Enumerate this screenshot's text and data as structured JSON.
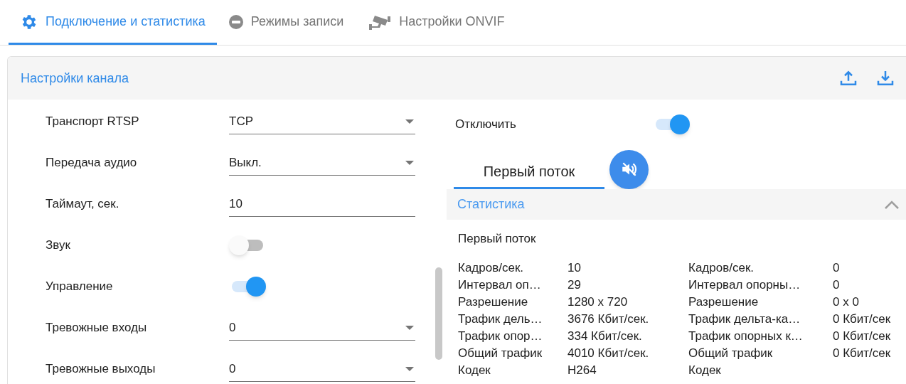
{
  "tabs": [
    {
      "label": "Подключение и статистика",
      "selected": true
    },
    {
      "label": "Режимы записи",
      "selected": false
    },
    {
      "label": "Настройки ONVIF",
      "selected": false
    }
  ],
  "panel": {
    "title": "Настройки канала",
    "settings": [
      {
        "kind": "select",
        "label": "Транспорт RTSP",
        "value": "TCP"
      },
      {
        "kind": "select",
        "label": "Передача аудио",
        "value": "Выкл."
      },
      {
        "kind": "input",
        "label": "Таймаут, сек.",
        "value": "10"
      },
      {
        "kind": "toggle",
        "label": "Звук",
        "on": false
      },
      {
        "kind": "toggle",
        "label": "Управление",
        "on": true
      },
      {
        "kind": "select",
        "label": "Тревожные входы",
        "value": "0"
      },
      {
        "kind": "select",
        "label": "Тревожные выходы",
        "value": "0"
      }
    ],
    "disable": {
      "label": "Отключить",
      "on": true
    },
    "stream_tabs": [
      {
        "label": "Первый поток",
        "selected": true
      }
    ],
    "statistics": {
      "title": "Статистика",
      "expanded": true,
      "stream_title": "Первый поток",
      "columns": [
        {
          "rows": [
            {
              "label": "Кадров/сек.",
              "value": "10"
            },
            {
              "label": "Интервал оп…",
              "value": "29"
            },
            {
              "label": "Разрешение",
              "value": "1280 x 720"
            },
            {
              "label": "Трафик дель…",
              "value": "3676 Кбит/сек."
            },
            {
              "label": "Трафик опор…",
              "value": "334 Кбит/сек."
            },
            {
              "label": "Общий трафик",
              "value": "4010 Кбит/сек."
            },
            {
              "label": "Кодек",
              "value": "H264"
            }
          ]
        },
        {
          "rows": [
            {
              "label": "Кадров/сек.",
              "value": "0"
            },
            {
              "label": "Интервал опорны…",
              "value": "0"
            },
            {
              "label": "Разрешение",
              "value": "0 x 0"
            },
            {
              "label": "Трафик дельта-ка…",
              "value": "0 Кбит/сек"
            },
            {
              "label": "Трафик опорных к…",
              "value": "0 Кбит/сек"
            },
            {
              "label": "Общий трафик",
              "value": "0 Кбит/сек"
            },
            {
              "label": "Кодек"
            }
          ]
        }
      ]
    }
  }
}
